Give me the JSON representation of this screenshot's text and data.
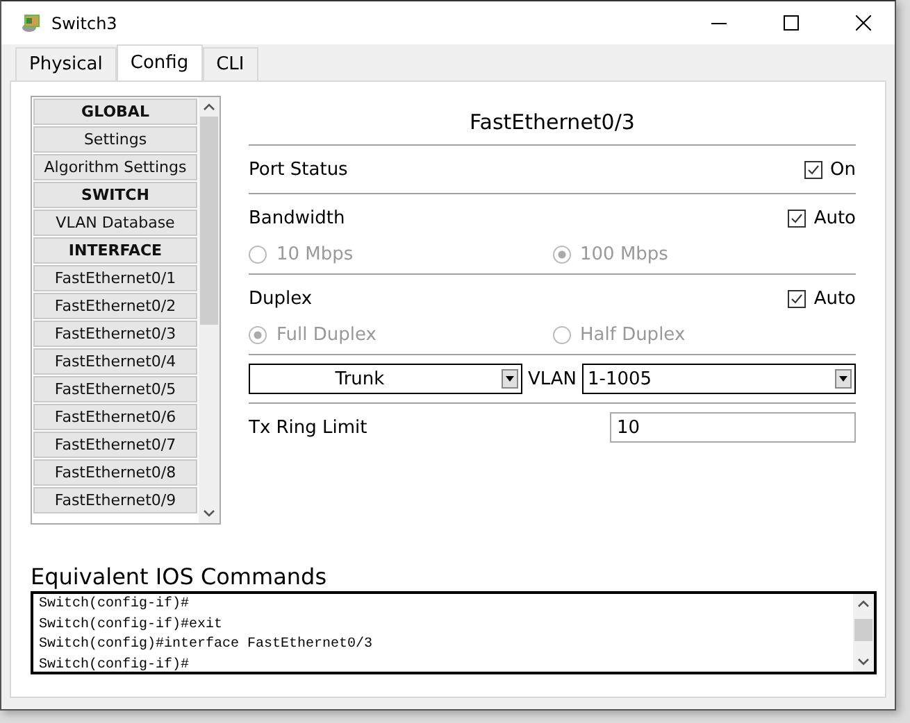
{
  "window": {
    "title": "Switch3"
  },
  "tabs": [
    {
      "label": "Physical",
      "selected": false
    },
    {
      "label": "Config",
      "selected": true
    },
    {
      "label": "CLI",
      "selected": false
    }
  ],
  "sidebar": {
    "items": [
      {
        "kind": "header",
        "label": "GLOBAL",
        "selected": false
      },
      {
        "kind": "item",
        "label": "Settings",
        "selected": false
      },
      {
        "kind": "item",
        "label": "Algorithm Settings",
        "selected": false
      },
      {
        "kind": "header",
        "label": "SWITCH",
        "selected": false
      },
      {
        "kind": "item",
        "label": "VLAN Database",
        "selected": false
      },
      {
        "kind": "header",
        "label": "INTERFACE",
        "selected": false
      },
      {
        "kind": "item",
        "label": "FastEthernet0/1",
        "selected": false
      },
      {
        "kind": "item",
        "label": "FastEthernet0/2",
        "selected": false
      },
      {
        "kind": "item",
        "label": "FastEthernet0/3",
        "selected": false
      },
      {
        "kind": "item",
        "label": "FastEthernet0/4",
        "selected": false
      },
      {
        "kind": "item",
        "label": "FastEthernet0/5",
        "selected": false
      },
      {
        "kind": "item",
        "label": "FastEthernet0/6",
        "selected": false
      },
      {
        "kind": "item",
        "label": "FastEthernet0/7",
        "selected": false
      },
      {
        "kind": "item",
        "label": "FastEthernet0/8",
        "selected": false
      },
      {
        "kind": "item",
        "label": "FastEthernet0/9",
        "selected": false
      }
    ]
  },
  "panel": {
    "title": "FastEthernet0/3",
    "port_status": {
      "label": "Port Status",
      "checkbox": {
        "label": "On",
        "checked": true
      }
    },
    "bandwidth": {
      "label": "Bandwidth",
      "checkbox": {
        "label": "Auto",
        "checked": true
      },
      "options": [
        {
          "label": "10 Mbps",
          "selected": false,
          "disabled": true
        },
        {
          "label": "100 Mbps",
          "selected": true,
          "disabled": true
        }
      ]
    },
    "duplex": {
      "label": "Duplex",
      "checkbox": {
        "label": "Auto",
        "checked": true
      },
      "options": [
        {
          "label": "Full Duplex",
          "selected": true,
          "disabled": true
        },
        {
          "label": "Half Duplex",
          "selected": false,
          "disabled": true
        }
      ]
    },
    "mode": {
      "value": "Trunk"
    },
    "vlan": {
      "label": "VLAN",
      "value": "1-1005"
    },
    "tx_ring_limit": {
      "label": "Tx Ring Limit",
      "value": "10"
    }
  },
  "ios_commands": {
    "title": "Equivalent IOS Commands",
    "lines": [
      "Switch(config-if)#",
      "Switch(config-if)#exit",
      "Switch(config)#interface FastEthernet0/3",
      "Switch(config-if)#"
    ]
  }
}
